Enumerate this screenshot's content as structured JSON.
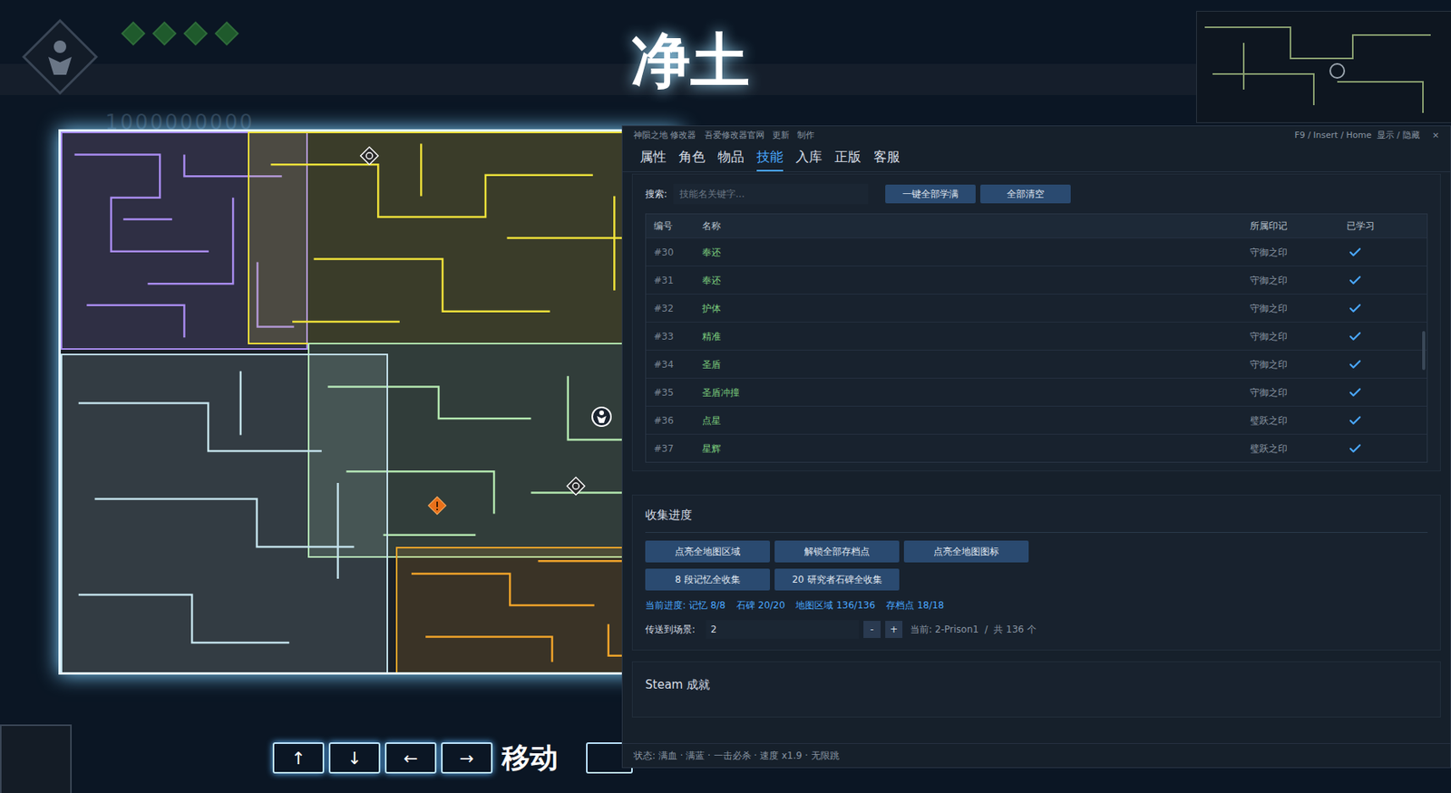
{
  "hud": {
    "score": "1000000000",
    "gems": [
      {
        "filled": true
      },
      {
        "filled": true
      },
      {
        "filled": true
      },
      {
        "filled": true
      }
    ]
  },
  "title": "净土",
  "map": {
    "regions": [
      {
        "color": "#a98cf0"
      },
      {
        "color": "#f0e23a"
      },
      {
        "color": "#b4e8b0"
      },
      {
        "color": "#c4e2ec"
      },
      {
        "color": "#f2a52a"
      }
    ],
    "pins": [
      {
        "kind": "save"
      },
      {
        "kind": "player"
      },
      {
        "kind": "save"
      },
      {
        "kind": "warning"
      }
    ]
  },
  "controls": {
    "keys": [
      "↑",
      "↓",
      "←",
      "→"
    ],
    "label": "移动"
  },
  "trainer": {
    "header": {
      "items": [
        "神陨之地 修改器",
        "吾爱修改器官网",
        "更新",
        "制作"
      ],
      "hotkey": "F9 / Insert / Home  显示 / 隐藏",
      "close": "×"
    },
    "tabs": [
      {
        "label": "属性",
        "selected": false
      },
      {
        "label": "角色",
        "selected": false
      },
      {
        "label": "物品",
        "selected": false
      },
      {
        "label": "技能",
        "selected": true
      },
      {
        "label": "入库",
        "selected": false
      },
      {
        "label": "正版",
        "selected": false
      },
      {
        "label": "客服",
        "selected": false
      }
    ],
    "search": {
      "label": "搜索:",
      "placeholder": "技能名关键字..."
    },
    "actions": [
      "一键全部学满",
      "全部清空"
    ],
    "table": {
      "columns": [
        "编号",
        "名称",
        "所属印记",
        "已学习"
      ],
      "rows": [
        {
          "id": "#30",
          "name": "奉还",
          "mark": "守御之印",
          "learned": true
        },
        {
          "id": "#31",
          "name": "奉还",
          "mark": "守御之印",
          "learned": true
        },
        {
          "id": "#32",
          "name": "护体",
          "mark": "守御之印",
          "learned": true
        },
        {
          "id": "#33",
          "name": "精准",
          "mark": "守御之印",
          "learned": true
        },
        {
          "id": "#34",
          "name": "圣盾",
          "mark": "守御之印",
          "learned": true
        },
        {
          "id": "#35",
          "name": "圣盾冲撞",
          "mark": "守御之印",
          "learned": true
        },
        {
          "id": "#36",
          "name": "点星",
          "mark": "璧跃之印",
          "learned": true
        },
        {
          "id": "#37",
          "name": "星辉",
          "mark": "璧跃之印",
          "learned": true
        }
      ]
    },
    "collect": {
      "title": "收集进度",
      "buttons": [
        [
          "点亮全地图区域",
          "解锁全部存档点",
          "点亮全地图图标"
        ],
        [
          "8 段记忆全收集",
          "20 研究者石碑全收集"
        ]
      ],
      "progress": [
        "当前进度: 记忆 8/8",
        "石碑 20/20",
        "地图区域 136/136",
        "存档点 18/18"
      ],
      "teleport": {
        "label": "传送到场景:",
        "value": "2",
        "minus": "-",
        "plus": "+",
        "current": "当前: 2-Prison1  /  共 136 个"
      }
    },
    "steam": {
      "title": "Steam 成就"
    },
    "status": "状态: 满血 · 满蓝 · 一击必杀 · 速度 x1.9 · 无限跳"
  }
}
